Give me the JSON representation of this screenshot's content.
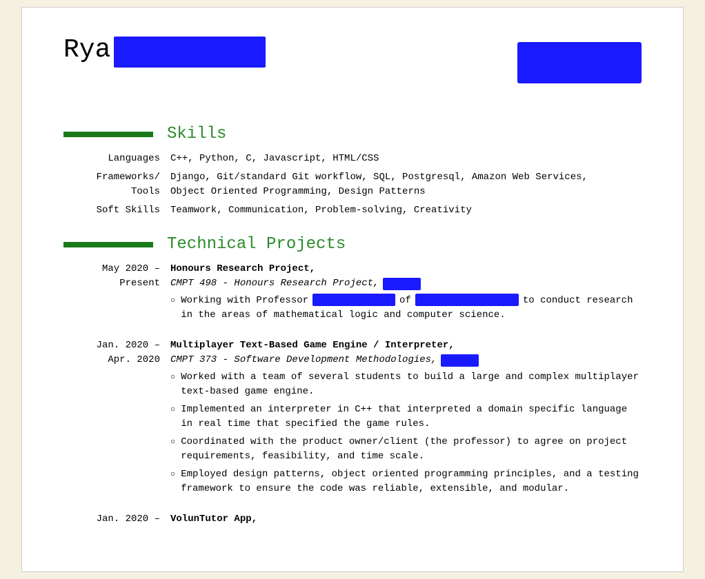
{
  "header": {
    "name_partial": "Rya",
    "name_redacted": true,
    "contact_redacted": true
  },
  "sections": {
    "skills": {
      "title": "Skills",
      "rows": [
        {
          "label": "Languages",
          "value": "C++, Python, C, Javascript, HTML/CSS"
        },
        {
          "label": "Frameworks/",
          "label2": "Tools",
          "value": "Django, Git/standard Git workflow, SQL, Postgresql, Amazon Web Services,",
          "value2": "Object Oriented Programming, Design Patterns"
        },
        {
          "label": "Soft Skills",
          "value": "Teamwork, Communication, Problem-solving, Creativity"
        }
      ]
    },
    "projects": {
      "title": "Technical Projects",
      "entries": [
        {
          "date_line1": "May 2020 –",
          "date_line2": "Present",
          "title": "Honours Research Project",
          "title_suffix": ",",
          "subtitle_prefix": "CMPT 498 - Honours Research Project,",
          "subtitle_redacted": true,
          "subtitle_redacted_size": "sm",
          "bullets": [
            {
              "text_prefix": "Working with Professor",
              "redacted1": true,
              "redacted1_size": "md",
              "text_middle": "of",
              "redacted2": true,
              "redacted2_size": "lg",
              "text_suffix": "to conduct research in the areas of mathematical logic and computer science."
            }
          ]
        },
        {
          "date_line1": "Jan. 2020 –",
          "date_line2": "Apr. 2020",
          "title": "Multiplayer Text-Based Game Engine / Interpreter",
          "title_suffix": ",",
          "subtitle_prefix": "CMPT 373 - Software Development Methodologies,",
          "subtitle_redacted": true,
          "subtitle_redacted_size": "sm",
          "bullets": [
            {
              "text": "Worked with a team of several students to build a large and complex multiplayer text-based game engine."
            },
            {
              "text": "Implemented an interpreter in C++ that interpreted a domain specific language in real time that specified the game rules."
            },
            {
              "text": "Coordinated with the product owner/client (the professor) to agree on project requirements, feasibility, and time scale."
            },
            {
              "text": "Employed design patterns, object oriented programming principles, and a testing framework to ensure the code was reliable, extensible, and modular."
            }
          ]
        },
        {
          "date_line1": "Jan. 2020 –",
          "date_line2": "",
          "title": "VolunTutor App",
          "title_suffix": ","
        }
      ]
    }
  },
  "labels": {
    "skills_bar": "skills-section-bar",
    "projects_bar": "projects-section-bar"
  }
}
